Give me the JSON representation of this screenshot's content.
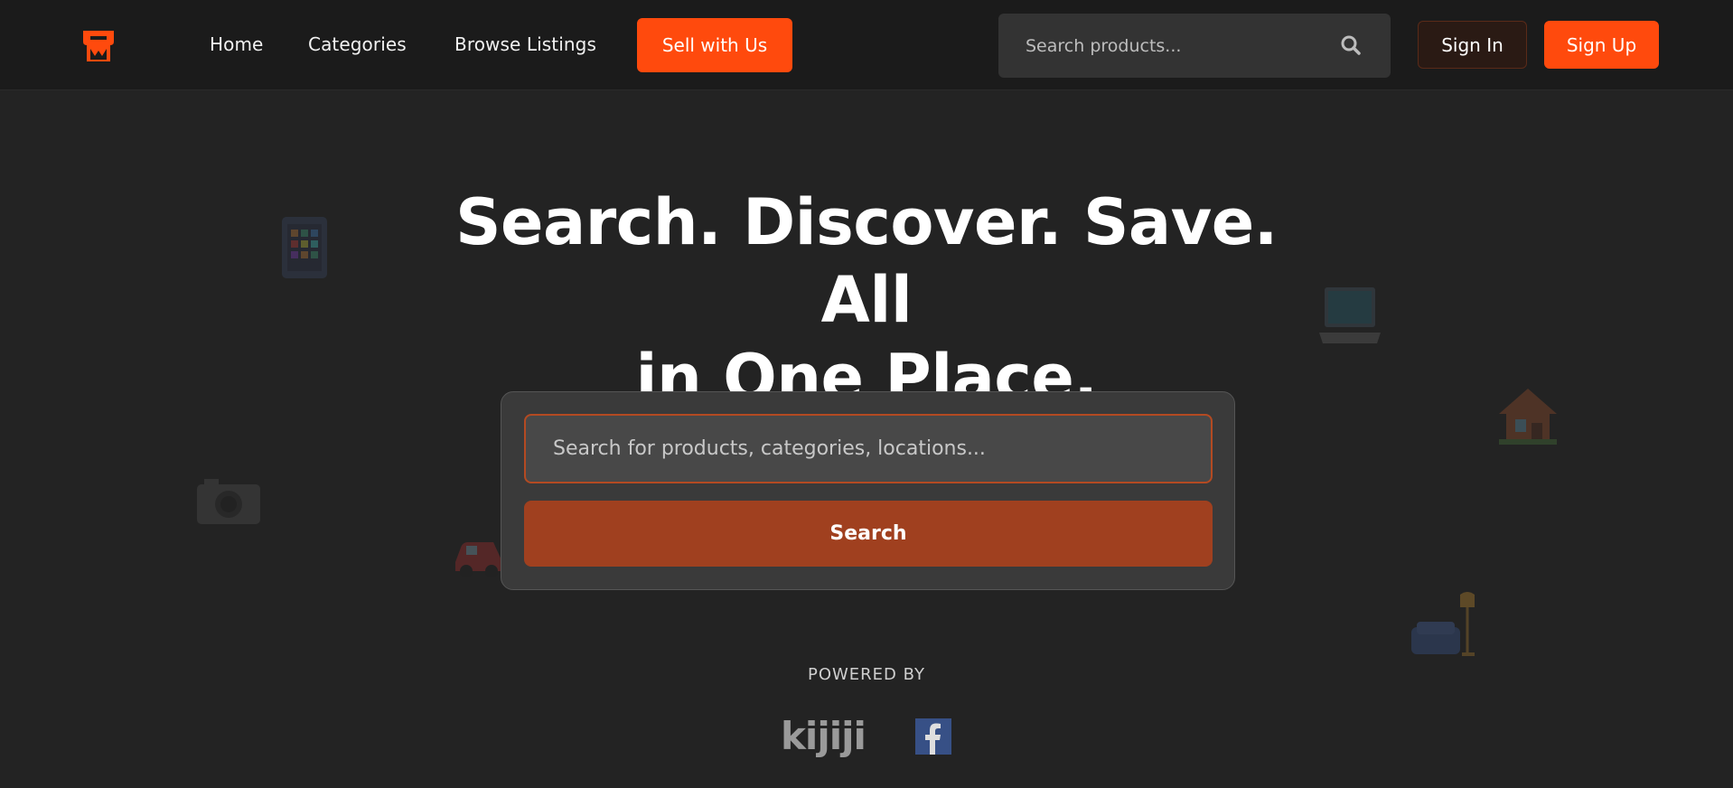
{
  "nav": {
    "links": [
      "Home",
      "Categories",
      "Browse Listings"
    ],
    "sell_label": "Sell with Us",
    "search_placeholder": "Search products...",
    "signin_label": "Sign In",
    "signup_label": "Sign Up"
  },
  "hero": {
    "title_line1": "Search. Discover. Save. All",
    "title_line2": "in One Place.",
    "search_placeholder": "Search for products, categories, locations...",
    "search_button": "Search"
  },
  "footer": {
    "powered_by": "POWERED BY",
    "partners": [
      "kijiji",
      "facebook"
    ]
  },
  "colors": {
    "accent": "#ff4a0d",
    "background": "#232323",
    "nav_background": "#1b1b1b"
  },
  "icons": [
    "store-logo-icon",
    "search-icon",
    "tablet-icon",
    "laptop-icon",
    "house-icon",
    "camera-icon",
    "car-icon",
    "sofa-lamp-icon",
    "kijiji-logo",
    "facebook-icon"
  ]
}
